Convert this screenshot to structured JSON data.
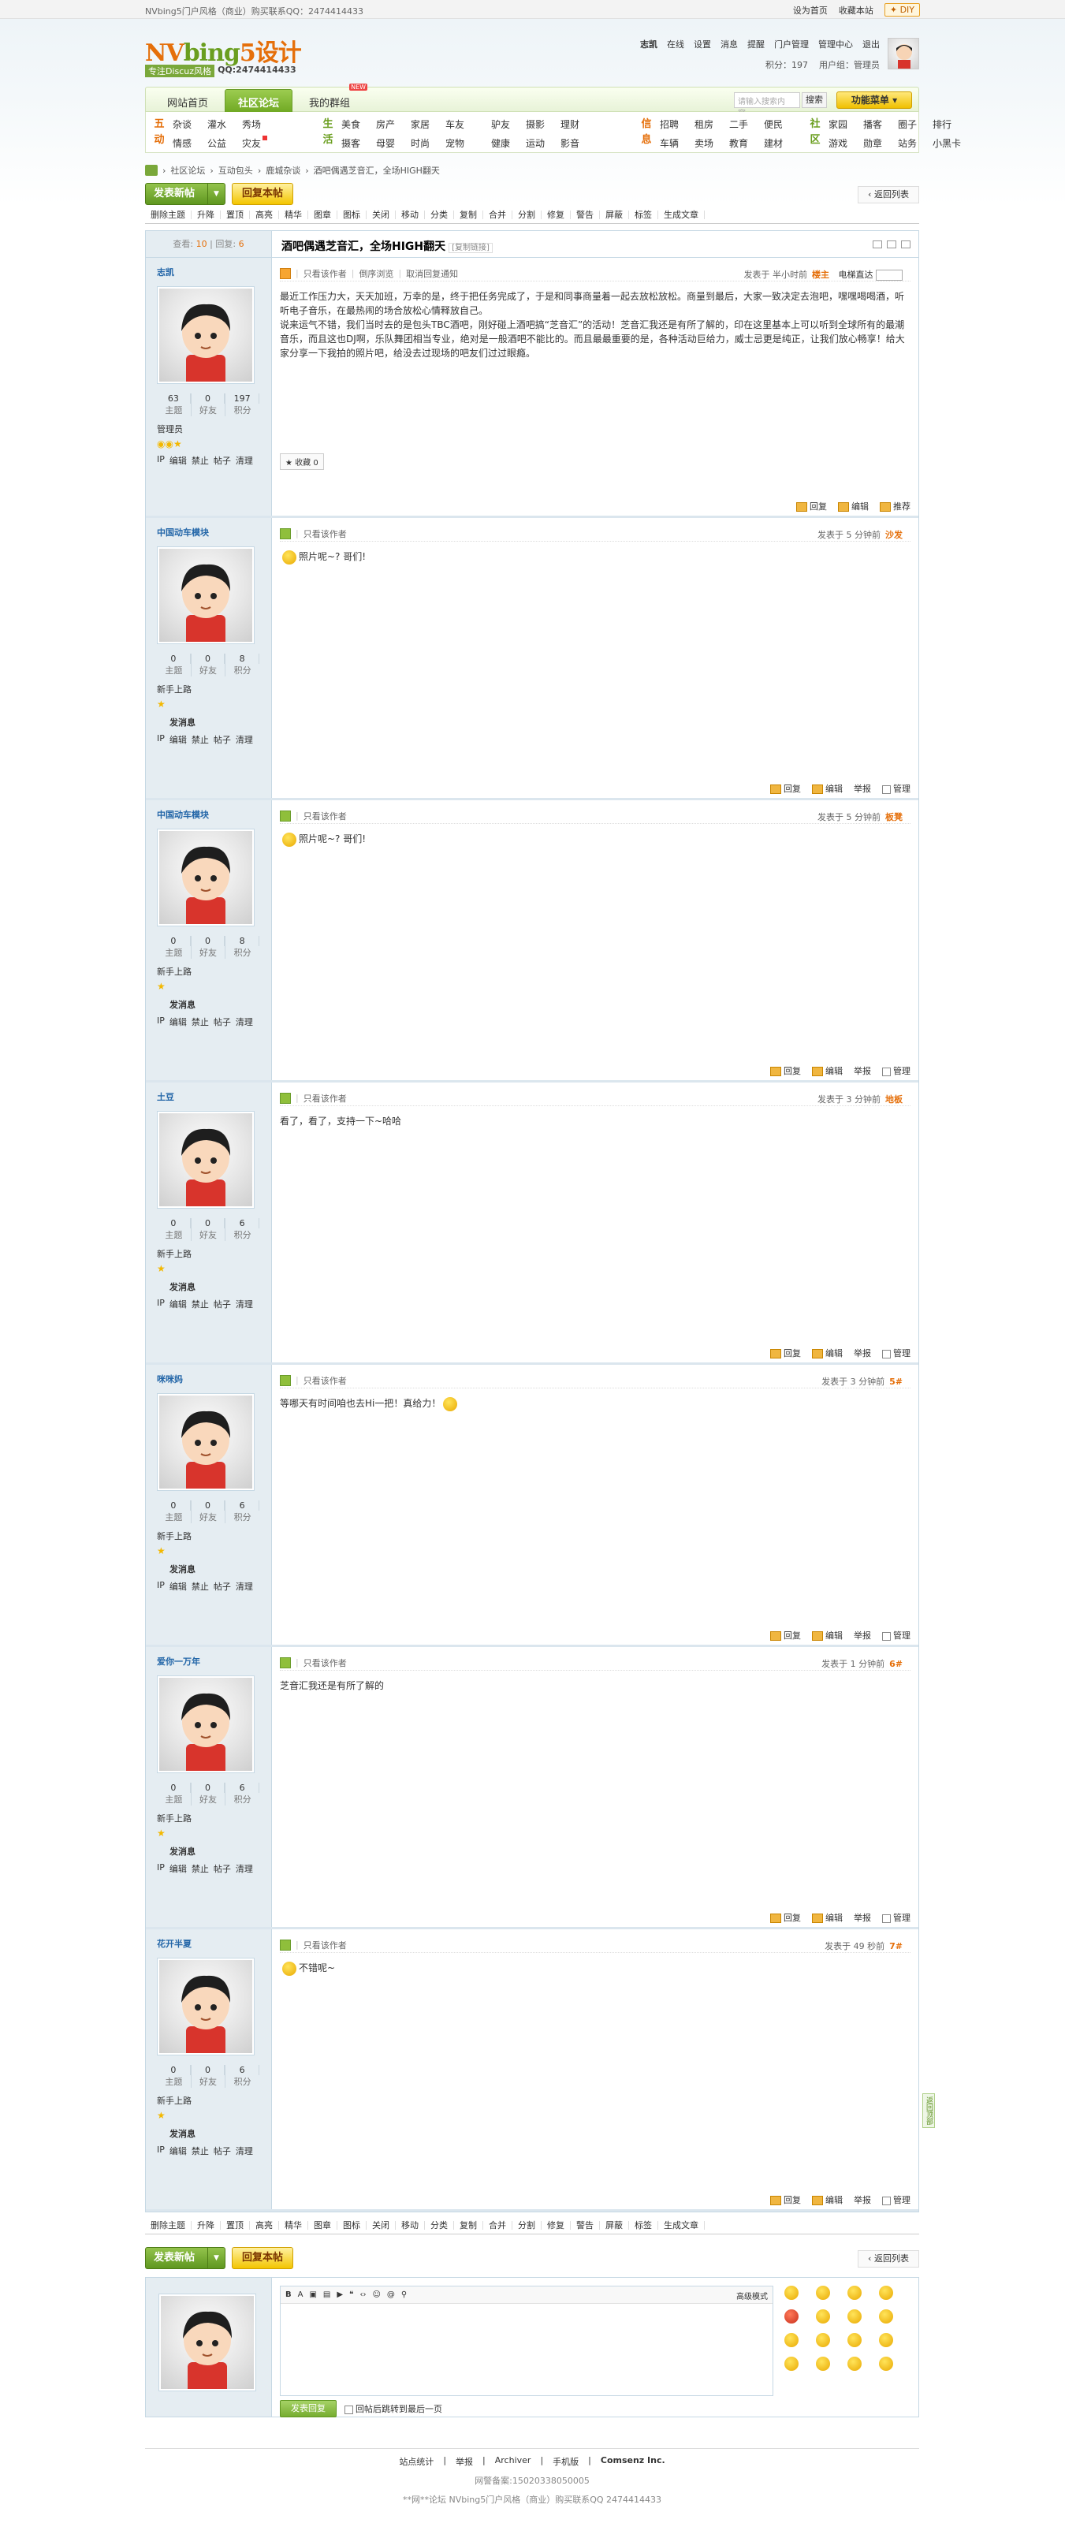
{
  "topbar": {
    "left": "NVbing5门户风格（商业）购买联系QQ：2474414433",
    "links": [
      "设为首页",
      "收藏本站"
    ],
    "diy": "DIY"
  },
  "logo": {
    "main_a": "NV",
    "main_b": "bing",
    "main_c": "5设计",
    "tag": "专注Discuz风格",
    "qq": "QQ:2474414433"
  },
  "user": {
    "links": [
      "志凯",
      "在线",
      "设置",
      "消息",
      "提醒",
      "门户管理",
      "管理中心",
      "退出"
    ],
    "points": "积分：197",
    "group": "用户组：管理员"
  },
  "nav": {
    "tabs": [
      "网站首页",
      "社区论坛",
      "我的群组"
    ],
    "new_badge": "NEW",
    "search_placeholder": "请输入搜索内容...",
    "search_btn": "搜索",
    "func": "功能菜单"
  },
  "subnav": [
    {
      "cap": "五动",
      "cap_color": "orange",
      "items": [
        "杂谈",
        "灌水",
        "秀场",
        "",
        "情感",
        "公益",
        "灾友",
        ""
      ]
    },
    {
      "cap": "生活",
      "cap_color": "green",
      "items": [
        "美食",
        "房产",
        "家居",
        "车友",
        "摄客",
        "母婴",
        "时尚",
        "宠物"
      ]
    },
    {
      "cap": "",
      "cap_color": "green",
      "items": [
        "驴友",
        "摄影",
        "理财",
        "",
        "健康",
        "运动",
        "影音",
        ""
      ]
    },
    {
      "cap": "信息",
      "cap_color": "orange",
      "items": [
        "招聘",
        "租房",
        "二手",
        "便民",
        "车辆",
        "卖场",
        "教育",
        "建材"
      ]
    },
    {
      "cap": "社区",
      "cap_color": "green",
      "items": [
        "家园",
        "播客",
        "圈子",
        "排行",
        "游戏",
        "勋章",
        "站务",
        "小黑卡"
      ]
    }
  ],
  "breadcrumb": [
    "社区论坛",
    "互动包头",
    "鹿城杂谈",
    "酒吧偶遇芝音汇，全场HIGH翻天"
  ],
  "buttons": {
    "post": "发表新帖",
    "reply": "回复本帖",
    "back": "返回列表"
  },
  "modbar": [
    "删除主题",
    "升降",
    "置顶",
    "高亮",
    "精华",
    "图章",
    "图标",
    "关闭",
    "移动",
    "分类",
    "复制",
    "合并",
    "分割",
    "修复",
    "警告",
    "屏蔽",
    "标签",
    "生成文章"
  ],
  "thread": {
    "views_label": "查看:",
    "views": "10",
    "replies_label": "回复:",
    "replies": "6",
    "title": "酒吧偶遇芝音汇，全场HIGH翻天",
    "copy_link": "[复制链接]"
  },
  "labels": {
    "topics": "主题",
    "friends": "好友",
    "points": "积分",
    "only_author": "只看该作者",
    "reverse": "倒序浏览",
    "cancel_notice": "取消回复通知",
    "electric": "电梯直达",
    "reply": "回复",
    "edit": "编辑",
    "report": "举报",
    "manage": "管理",
    "promote": "推荐",
    "fav": "收藏",
    "send_msg": "发消息",
    "ops": [
      "IP",
      "编辑",
      "禁止",
      "帖子",
      "清理"
    ]
  },
  "posts": [
    {
      "name": "志凯",
      "topics": "63",
      "friends": "0",
      "points": "197",
      "rank": "管理员",
      "time": "发表于 半小时前",
      "floor": "楼主",
      "body": "最近工作压力大，天天加班，万幸的是，终于把任务完成了，于是和同事商量着一起去放松放松。商量到最后，大家一致决定去泡吧，嘿嘿喝喝酒，听听电子音乐，在最热闹的场合放松心情释放自己。\n说来运气不错，我们当时去的是包头TBC酒吧，刚好碰上酒吧搞“芝音汇”的活动！芝音汇我还是有所了解的，印在这里基本上可以听到全球所有的最潮音乐，而且这也DJ啊，乐队舞团相当专业，绝对是一般酒吧不能比的。而且最最重要的是，各种活动巨给力，威士忌更是纯正，让我们放心畅享！给大家分享一下我拍的照片吧，给没去过现场的吧友们过过眼瘾。",
      "first": true
    },
    {
      "name": "中国动车模块",
      "topics": "0",
      "friends": "0",
      "points": "8",
      "rank": "新手上路",
      "time": "发表于 5 分钟前",
      "floor": "沙发",
      "body": "照片呢~? 哥们!"
    },
    {
      "name": "中国动车模块",
      "topics": "0",
      "friends": "0",
      "points": "8",
      "rank": "新手上路",
      "time": "发表于 5 分钟前",
      "floor": "板凳",
      "body": "照片呢~? 哥们!"
    },
    {
      "name": "土豆",
      "topics": "0",
      "friends": "0",
      "points": "6",
      "rank": "新手上路",
      "time": "发表于 3 分钟前",
      "floor": "地板",
      "body": "看了，看了，支持一下~哈哈"
    },
    {
      "name": "咪咪妈",
      "topics": "0",
      "friends": "0",
      "points": "6",
      "rank": "新手上路",
      "time": "发表于 3 分钟前",
      "floor": "5#",
      "body": "等哪天有时间咱也去Hi一把！真给力！"
    },
    {
      "name": "爱你一万年",
      "topics": "0",
      "friends": "0",
      "points": "6",
      "rank": "新手上路",
      "time": "发表于 1 分钟前",
      "floor": "6#",
      "body": "芝音汇我还是有所了解的"
    },
    {
      "name": "花开半夏",
      "topics": "0",
      "friends": "0",
      "points": "6",
      "rank": "新手上路",
      "time": "发表于 49 秒前",
      "floor": "7#",
      "body": "不错呢~"
    }
  ],
  "editor": {
    "mode": "高级模式",
    "submit": "发表回复",
    "after_submit": "回帖后跳转到最后一页"
  },
  "footer": {
    "links": [
      "站点统计",
      "举报",
      "Archiver",
      "手机版",
      "Comsenz Inc."
    ],
    "icp": "网警备案:15020338050005",
    "copy": "**网**论坛 NVbing5门户风格（商业）购买联系QQ 2474414433"
  },
  "sidetab": "返回顶部"
}
